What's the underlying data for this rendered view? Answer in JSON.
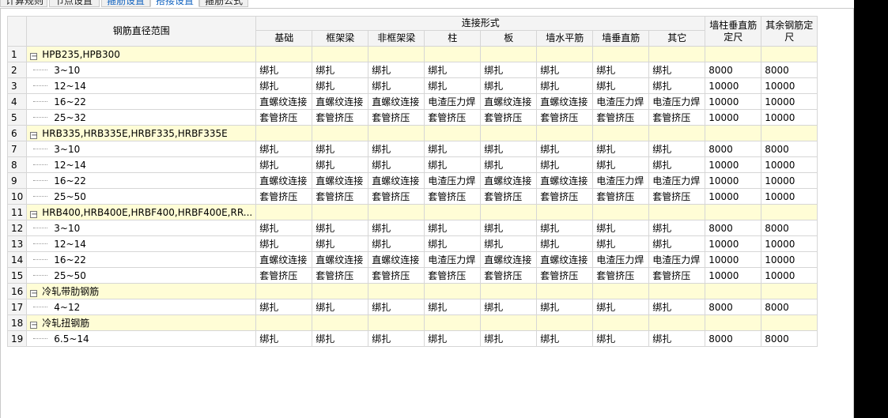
{
  "tabs": [
    {
      "label": "计算规则",
      "style": "normal"
    },
    {
      "label": "节点设置",
      "style": "normal"
    },
    {
      "label": "箍筋设置",
      "style": "blue"
    },
    {
      "label": "搭接设置",
      "style": "active"
    },
    {
      "label": "箍筋公式",
      "style": "normal"
    }
  ],
  "header": {
    "range_label": "钢筋直径范围",
    "connection_label": "连接形式",
    "columns": [
      "基础",
      "框架梁",
      "非框架梁",
      "柱",
      "板",
      "墙水平筋",
      "墙垂直筋",
      "其它"
    ],
    "wall_col_label_1": "墙柱垂直筋",
    "wall_col_label_2": "定尺",
    "other_label_1": "其余钢筋定",
    "other_label_2": "尺"
  },
  "rows": [
    {
      "n": "1",
      "type": "group",
      "label": "HPB235,HPB300"
    },
    {
      "n": "2",
      "type": "item",
      "label": "3~10",
      "c": [
        "绑扎",
        "绑扎",
        "绑扎",
        "绑扎",
        "绑扎",
        "绑扎",
        "绑扎",
        "绑扎"
      ],
      "d1": "8000",
      "d2": "8000"
    },
    {
      "n": "3",
      "type": "item",
      "label": "12~14",
      "c": [
        "绑扎",
        "绑扎",
        "绑扎",
        "绑扎",
        "绑扎",
        "绑扎",
        "绑扎",
        "绑扎"
      ],
      "d1": "10000",
      "d2": "10000"
    },
    {
      "n": "4",
      "type": "item",
      "label": "16~22",
      "c": [
        "直螺纹连接",
        "直螺纹连接",
        "直螺纹连接",
        "电渣压力焊",
        "直螺纹连接",
        "直螺纹连接",
        "电渣压力焊",
        "电渣压力焊"
      ],
      "d1": "10000",
      "d2": "10000"
    },
    {
      "n": "5",
      "type": "item",
      "label": "25~32",
      "c": [
        "套管挤压",
        "套管挤压",
        "套管挤压",
        "套管挤压",
        "套管挤压",
        "套管挤压",
        "套管挤压",
        "套管挤压"
      ],
      "d1": "10000",
      "d2": "10000"
    },
    {
      "n": "6",
      "type": "group",
      "label": "HRB335,HRB335E,HRBF335,HRBF335E"
    },
    {
      "n": "7",
      "type": "item",
      "label": "3~10",
      "c": [
        "绑扎",
        "绑扎",
        "绑扎",
        "绑扎",
        "绑扎",
        "绑扎",
        "绑扎",
        "绑扎"
      ],
      "d1": "8000",
      "d2": "8000"
    },
    {
      "n": "8",
      "type": "item",
      "label": "12~14",
      "c": [
        "绑扎",
        "绑扎",
        "绑扎",
        "绑扎",
        "绑扎",
        "绑扎",
        "绑扎",
        "绑扎"
      ],
      "d1": "10000",
      "d2": "10000"
    },
    {
      "n": "9",
      "type": "item",
      "label": "16~22",
      "c": [
        "直螺纹连接",
        "直螺纹连接",
        "直螺纹连接",
        "电渣压力焊",
        "直螺纹连接",
        "直螺纹连接",
        "电渣压力焊",
        "电渣压力焊"
      ],
      "d1": "10000",
      "d2": "10000"
    },
    {
      "n": "10",
      "type": "item",
      "label": "25~50",
      "c": [
        "套管挤压",
        "套管挤压",
        "套管挤压",
        "套管挤压",
        "套管挤压",
        "套管挤压",
        "套管挤压",
        "套管挤压"
      ],
      "d1": "10000",
      "d2": "10000"
    },
    {
      "n": "11",
      "type": "group",
      "label": "HRB400,HRB400E,HRBF400,HRBF400E,RR..."
    },
    {
      "n": "12",
      "type": "item",
      "label": "3~10",
      "c": [
        "绑扎",
        "绑扎",
        "绑扎",
        "绑扎",
        "绑扎",
        "绑扎",
        "绑扎",
        "绑扎"
      ],
      "d1": "8000",
      "d2": "8000"
    },
    {
      "n": "13",
      "type": "item",
      "label": "12~14",
      "c": [
        "绑扎",
        "绑扎",
        "绑扎",
        "绑扎",
        "绑扎",
        "绑扎",
        "绑扎",
        "绑扎"
      ],
      "d1": "10000",
      "d2": "10000"
    },
    {
      "n": "14",
      "type": "item",
      "label": "16~22",
      "c": [
        "直螺纹连接",
        "直螺纹连接",
        "直螺纹连接",
        "电渣压力焊",
        "直螺纹连接",
        "直螺纹连接",
        "电渣压力焊",
        "电渣压力焊"
      ],
      "d1": "10000",
      "d2": "10000"
    },
    {
      "n": "15",
      "type": "item",
      "label": "25~50",
      "c": [
        "套管挤压",
        "套管挤压",
        "套管挤压",
        "套管挤压",
        "套管挤压",
        "套管挤压",
        "套管挤压",
        "套管挤压"
      ],
      "d1": "10000",
      "d2": "10000"
    },
    {
      "n": "16",
      "type": "group",
      "label": "冷轧带肋钢筋"
    },
    {
      "n": "17",
      "type": "item",
      "label": "4~12",
      "c": [
        "绑扎",
        "绑扎",
        "绑扎",
        "绑扎",
        "绑扎",
        "绑扎",
        "绑扎",
        "绑扎"
      ],
      "d1": "8000",
      "d2": "8000"
    },
    {
      "n": "18",
      "type": "group",
      "label": "冷轧扭钢筋"
    },
    {
      "n": "19",
      "type": "item",
      "label": "6.5~14",
      "c": [
        "绑扎",
        "绑扎",
        "绑扎",
        "绑扎",
        "绑扎",
        "绑扎",
        "绑扎",
        "绑扎"
      ],
      "d1": "8000",
      "d2": "8000"
    }
  ]
}
